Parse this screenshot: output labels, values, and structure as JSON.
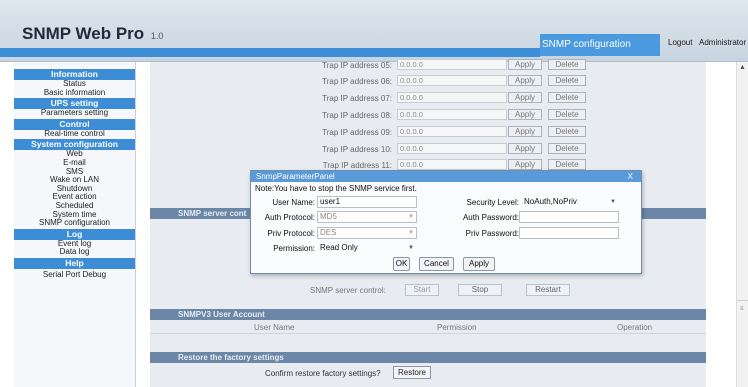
{
  "header": {
    "title": "SNMP Web Pro",
    "version": "1.0",
    "page_title": "SNMP configuration",
    "logout": "Logout",
    "user": "Administrator"
  },
  "sidebar": {
    "sections": [
      {
        "title": "Information",
        "items": [
          "Status",
          "Basic information"
        ]
      },
      {
        "title": "UPS setting",
        "items": [
          "Parameters setting"
        ]
      },
      {
        "title": "Control",
        "items": [
          "Real-time control"
        ]
      },
      {
        "title": "System configuration",
        "items": [
          "Web",
          "E-mail",
          "SMS",
          "Wake on LAN",
          "Shutdown",
          "Event action",
          "Scheduled",
          "System time",
          "SNMP configuration"
        ]
      },
      {
        "title": "Log",
        "items": [
          "Event log",
          "Data log"
        ]
      },
      {
        "title": "Help",
        "items": [
          "Serial Port Debug"
        ]
      }
    ]
  },
  "trap_rows": [
    {
      "label": "Trap IP address 05:",
      "value": "0.0.0.0"
    },
    {
      "label": "Trap IP address 06:",
      "value": "0.0.0.0"
    },
    {
      "label": "Trap IP address 07:",
      "value": "0.0.0.0"
    },
    {
      "label": "Trap IP address 08:",
      "value": "0.0.0.0"
    },
    {
      "label": "Trap IP address 09:",
      "value": "0.0.0.0"
    },
    {
      "label": "Trap IP address 10:",
      "value": "0.0.0.0"
    },
    {
      "label": "Trap IP address 11:",
      "value": "0.0.0.0"
    }
  ],
  "apply_label": "Apply",
  "delete_label": "Delete",
  "server_bar": "SNMP server cont",
  "server_control": {
    "label": "SNMP server control:",
    "start": "Start",
    "stop": "Stop",
    "restart": "Restart"
  },
  "snmpv3_bar": "SNMPV3 User Account",
  "snmpv3_columns": [
    "User Name",
    "Permission",
    "Operation"
  ],
  "restore_bar": "Restore the factory settings",
  "restore_label": "Confirm restore factory settings?",
  "restore_button": "Restore",
  "dialog": {
    "title": "SnmpParameterPanel",
    "close": "X",
    "note": "Note:You have to stop the SNMP service first.",
    "user_name_label": "User Name:",
    "user_name_value": "user1",
    "security_level_label": "Security Level:",
    "security_level_value": "NoAuth,NoPriv",
    "auth_protocol_label": "Auth Protocol:",
    "auth_protocol_value": "MD5",
    "auth_password_label": "Auth Password:",
    "priv_protocol_label": "Priv Protocol:",
    "priv_protocol_value": "DES",
    "priv_password_label": "Priv Password:",
    "permission_label": "Permission:",
    "permission_value": "Read Only",
    "ok": "OK",
    "cancel": "Cancel",
    "apply": "Apply"
  }
}
